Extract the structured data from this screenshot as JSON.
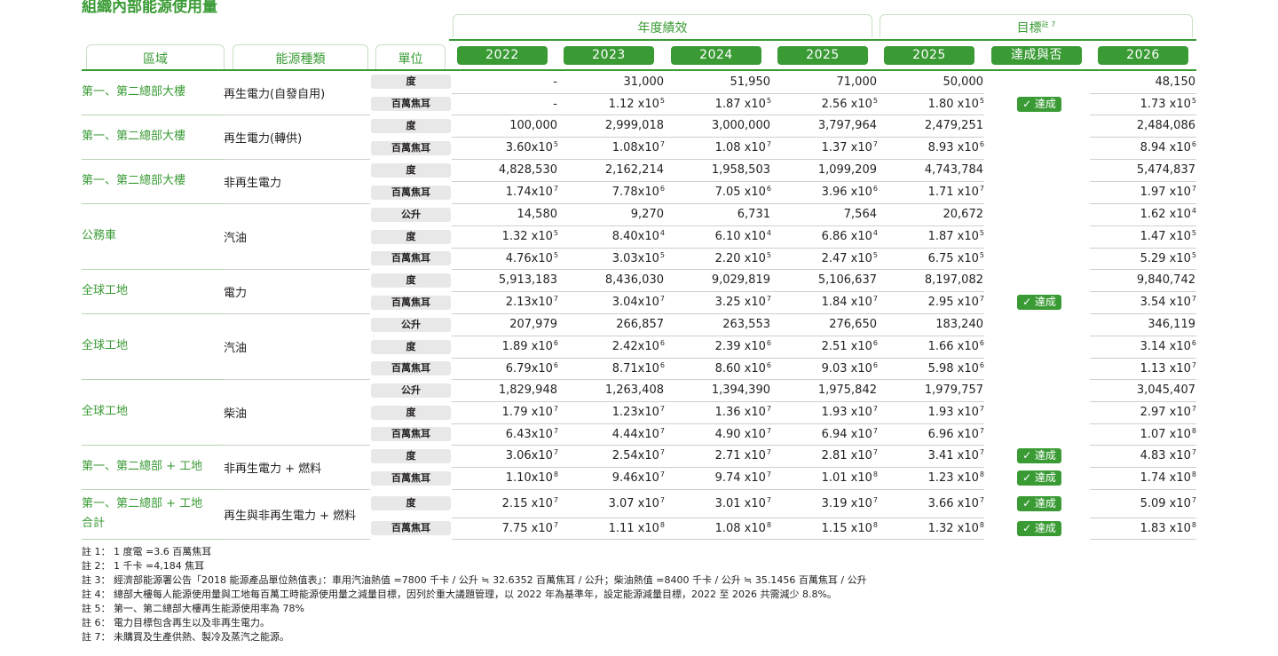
{
  "title": "組織內部能源使用量",
  "header": {
    "group_performance": "年度績效",
    "group_target": "目標",
    "group_target_note": "註 7",
    "region": "區域",
    "energy_type": "能源種類",
    "unit": "單位",
    "years": [
      "2022",
      "2023",
      "2024",
      "2025",
      "2025",
      "達成與否",
      "2026"
    ]
  },
  "rows": [
    {
      "region": "第一、第二總部大樓",
      "energy": "再生電力(自發自用)",
      "lines": [
        {
          "unit": "度",
          "v": [
            [
              "-",
              ""
            ],
            [
              "31,000",
              ""
            ],
            [
              "51,950",
              ""
            ],
            [
              "71,000",
              ""
            ],
            [
              "50,000",
              ""
            ]
          ],
          "ach": "",
          "t": [
            "48,150",
            ""
          ]
        },
        {
          "unit": "百萬焦耳",
          "v": [
            [
              "-",
              ""
            ],
            [
              "1.12 x10",
              "5"
            ],
            [
              "1.87 x10",
              "5"
            ],
            [
              "2.56 x10",
              "5"
            ],
            [
              "1.80 x10",
              "5"
            ]
          ],
          "ach": "✓ 達成",
          "t": [
            "1.73 x10",
            "5"
          ]
        }
      ]
    },
    {
      "region": "第一、第二總部大樓",
      "energy": "再生電力(轉供)",
      "lines": [
        {
          "unit": "度",
          "v": [
            [
              "100,000",
              ""
            ],
            [
              "2,999,018",
              ""
            ],
            [
              "3,000,000",
              ""
            ],
            [
              "3,797,964",
              ""
            ],
            [
              "2,479,251",
              ""
            ]
          ],
          "ach": "",
          "t": [
            "2,484,086",
            ""
          ]
        },
        {
          "unit": "百萬焦耳",
          "v": [
            [
              "3.60x10",
              "5"
            ],
            [
              "1.08x10",
              "7"
            ],
            [
              "1.08 x10",
              "7"
            ],
            [
              "1.37 x10",
              "7"
            ],
            [
              "8.93 x10",
              "6"
            ]
          ],
          "ach": "",
          "t": [
            "8.94 x10",
            "6"
          ]
        }
      ]
    },
    {
      "region": "第一、第二總部大樓",
      "energy": "非再生電力",
      "lines": [
        {
          "unit": "度",
          "v": [
            [
              "4,828,530",
              ""
            ],
            [
              "2,162,214",
              ""
            ],
            [
              "1,958,503",
              ""
            ],
            [
              "1,099,209",
              ""
            ],
            [
              "4,743,784",
              ""
            ]
          ],
          "ach": "",
          "t": [
            "5,474,837",
            ""
          ]
        },
        {
          "unit": "百萬焦耳",
          "v": [
            [
              "1.74x10",
              "7"
            ],
            [
              "7.78x10",
              "6"
            ],
            [
              "7.05 x10",
              "6"
            ],
            [
              "3.96 x10",
              "6"
            ],
            [
              "1.71 x10",
              "7"
            ]
          ],
          "ach": "",
          "t": [
            "1.97 x10",
            "7"
          ]
        }
      ]
    },
    {
      "region": "公務車",
      "energy": "汽油",
      "lines": [
        {
          "unit": "公升",
          "v": [
            [
              "14,580",
              ""
            ],
            [
              "9,270",
              ""
            ],
            [
              "6,731",
              ""
            ],
            [
              "7,564",
              ""
            ],
            [
              "20,672",
              ""
            ]
          ],
          "ach": "",
          "t": [
            "1.62 x10",
            "4"
          ]
        },
        {
          "unit": "度",
          "v": [
            [
              "1.32 x10",
              "5"
            ],
            [
              "8.40x10",
              "4"
            ],
            [
              "6.10 x10",
              "4"
            ],
            [
              "6.86 x10",
              "4"
            ],
            [
              "1.87 x10",
              "5"
            ]
          ],
          "ach": "",
          "t": [
            "1.47 x10",
            "5"
          ]
        },
        {
          "unit": "百萬焦耳",
          "v": [
            [
              "4.76x10",
              "5"
            ],
            [
              "3.03x10",
              "5"
            ],
            [
              "2.20 x10",
              "5"
            ],
            [
              "2.47 x10",
              "5"
            ],
            [
              "6.75 x10",
              "5"
            ]
          ],
          "ach": "",
          "t": [
            "5.29 x10",
            "5"
          ]
        }
      ]
    },
    {
      "region": "全球工地",
      "energy": "電力",
      "lines": [
        {
          "unit": "度",
          "v": [
            [
              "5,913,183",
              ""
            ],
            [
              "8,436,030",
              ""
            ],
            [
              "9,029,819",
              ""
            ],
            [
              "5,106,637",
              ""
            ],
            [
              "8,197,082",
              ""
            ]
          ],
          "ach": "",
          "t": [
            "9,840,742",
            ""
          ]
        },
        {
          "unit": "百萬焦耳",
          "v": [
            [
              "2.13x10",
              "7"
            ],
            [
              "3.04x10",
              "7"
            ],
            [
              "3.25 x10",
              "7"
            ],
            [
              "1.84 x10",
              "7"
            ],
            [
              "2.95 x10",
              "7"
            ]
          ],
          "ach": "✓ 達成",
          "t": [
            "3.54 x10",
            "7"
          ]
        }
      ]
    },
    {
      "region": "全球工地",
      "energy": "汽油",
      "lines": [
        {
          "unit": "公升",
          "v": [
            [
              "207,979",
              ""
            ],
            [
              "266,857",
              ""
            ],
            [
              "263,553",
              ""
            ],
            [
              "276,650",
              ""
            ],
            [
              "183,240",
              ""
            ]
          ],
          "ach": "",
          "t": [
            "346,119",
            ""
          ]
        },
        {
          "unit": "度",
          "v": [
            [
              "1.89 x10",
              "6"
            ],
            [
              "2.42x10",
              "6"
            ],
            [
              "2.39 x10",
              "6"
            ],
            [
              "2.51 x10",
              "6"
            ],
            [
              "1.66 x10",
              "6"
            ]
          ],
          "ach": "",
          "t": [
            "3.14 x10",
            "6"
          ]
        },
        {
          "unit": "百萬焦耳",
          "v": [
            [
              "6.79x10",
              "6"
            ],
            [
              "8.71x10",
              "6"
            ],
            [
              "8.60 x10",
              "6"
            ],
            [
              "9.03 x10",
              "6"
            ],
            [
              "5.98 x10",
              "6"
            ]
          ],
          "ach": "",
          "t": [
            "1.13 x10",
            "7"
          ]
        }
      ]
    },
    {
      "region": "全球工地",
      "energy": "柴油",
      "lines": [
        {
          "unit": "公升",
          "v": [
            [
              "1,829,948",
              ""
            ],
            [
              "1,263,408",
              ""
            ],
            [
              "1,394,390",
              ""
            ],
            [
              "1,975,842",
              ""
            ],
            [
              "1,979,757",
              ""
            ]
          ],
          "ach": "",
          "t": [
            "3,045,407",
            ""
          ]
        },
        {
          "unit": "度",
          "v": [
            [
              "1.79 x10",
              "7"
            ],
            [
              "1.23x10",
              "7"
            ],
            [
              "1.36 x10",
              "7"
            ],
            [
              "1.93 x10",
              "7"
            ],
            [
              "1.93 x10",
              "7"
            ]
          ],
          "ach": "",
          "t": [
            "2.97 x10",
            "7"
          ]
        },
        {
          "unit": "百萬焦耳",
          "v": [
            [
              "6.43x10",
              "7"
            ],
            [
              "4.44x10",
              "7"
            ],
            [
              "4.90 x10",
              "7"
            ],
            [
              "6.94 x10",
              "7"
            ],
            [
              "6.96 x10",
              "7"
            ]
          ],
          "ach": "",
          "t": [
            "1.07 x10",
            "8"
          ]
        }
      ]
    },
    {
      "region": "第一、第二總部 + 工地",
      "energy": "非再生電力 + 燃料",
      "lines": [
        {
          "unit": "度",
          "v": [
            [
              "3.06x10",
              "7"
            ],
            [
              "2.54x10",
              "7"
            ],
            [
              "2.71 x10",
              "7"
            ],
            [
              "2.81 x10",
              "7"
            ],
            [
              "3.41 x10",
              "7"
            ]
          ],
          "ach": "✓ 達成",
          "t": [
            "4.83 x10",
            "7"
          ]
        },
        {
          "unit": "百萬焦耳",
          "v": [
            [
              "1.10x10",
              "8"
            ],
            [
              "9.46x10",
              "7"
            ],
            [
              "9.74 x10",
              "7"
            ],
            [
              "1.01 x10",
              "8"
            ],
            [
              "1.23 x10",
              "8"
            ]
          ],
          "ach": "✓ 達成",
          "t": [
            "1.74 x10",
            "8"
          ]
        }
      ]
    },
    {
      "region": "第一、第二總部 + 工地\n合計",
      "energy": "再生與非再生電力 + 燃料",
      "lines": [
        {
          "unit": "度",
          "v": [
            [
              "2.15 x10",
              "7"
            ],
            [
              "3.07 x10",
              "7"
            ],
            [
              "3.01 x10",
              "7"
            ],
            [
              "3.19 x10",
              "7"
            ],
            [
              "3.66 x10",
              "7"
            ]
          ],
          "ach": "✓ 達成",
          "t": [
            "5.09 x10",
            "7"
          ]
        },
        {
          "unit": "百萬焦耳",
          "v": [
            [
              "7.75 x10",
              "7"
            ],
            [
              "1.11 x10",
              "8"
            ],
            [
              "1.08 x10",
              "8"
            ],
            [
              "1.15 x10",
              "8"
            ],
            [
              "1.32 x10",
              "8"
            ]
          ],
          "ach": "✓ 達成",
          "t": [
            "1.83 x10",
            "8"
          ]
        }
      ]
    }
  ],
  "notes": [
    "註 1： 1 度電 =3.6 百萬焦耳",
    "註 2： 1 千卡 =4,184 焦耳",
    "註 3： 經濟部能源署公告「2018 能源產品單位熱值表」：車用汽油熱值 =7800 千卡 / 公升 ≒ 32.6352 百萬焦耳 / 公升；柴油熱值 =8400 千卡 / 公升 ≒ 35.1456 百萬焦耳 / 公升",
    "註 4： 總部大樓每人能源使用量與工地每百萬工時能源使用量之減量目標，因列於重大議題管理，以 2022 年為基準年，設定能源減量目標，2022 至 2026 共需減少 8.8%。",
    "註 5： 第一、第二總部大樓再生能源使用率為 78%",
    "註 6： 電力目標包含再生以及非再生電力。",
    "註 7： 未購買及生產供熱、製冷及蒸汽之能源。"
  ]
}
